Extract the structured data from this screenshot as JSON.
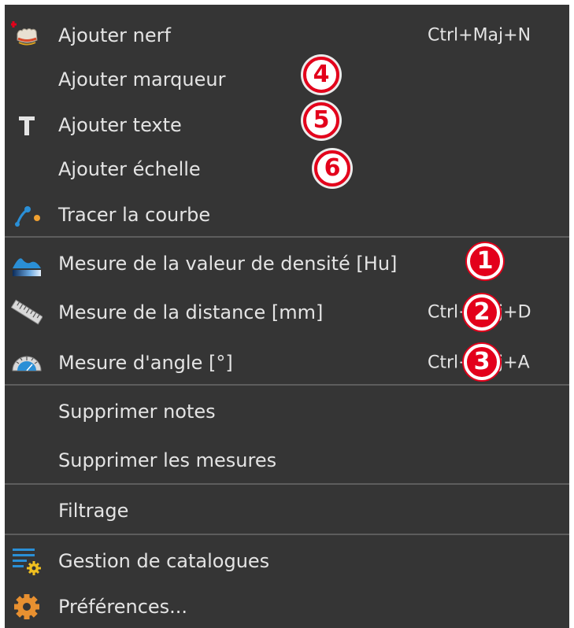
{
  "menu": {
    "items": [
      {
        "label": "Ajouter nerf",
        "shortcut": "Ctrl+Maj+N",
        "icon": "add-nerve-icon"
      },
      {
        "label": "Ajouter marqueur",
        "shortcut": "",
        "icon": ""
      },
      {
        "label": "Ajouter texte",
        "shortcut": "",
        "icon": "text-icon"
      },
      {
        "label": "Ajouter échelle",
        "shortcut": "",
        "icon": ""
      },
      {
        "label": "Tracer la courbe",
        "shortcut": "",
        "icon": "curve-icon"
      },
      {
        "label": "Mesure de la valeur de densité [Hu]",
        "shortcut": "",
        "icon": "density-icon"
      },
      {
        "label": "Mesure de la distance [mm]",
        "shortcut": "Ctrl+Maj+D",
        "icon": "ruler-icon"
      },
      {
        "label": "Mesure d'angle [°]",
        "shortcut": "Ctrl+Maj+A",
        "icon": "protractor-icon"
      },
      {
        "label": "Supprimer notes",
        "shortcut": "",
        "icon": ""
      },
      {
        "label": "Supprimer les mesures",
        "shortcut": "",
        "icon": ""
      },
      {
        "label": "Filtrage",
        "shortcut": "",
        "icon": ""
      },
      {
        "label": "Gestion de catalogues",
        "shortcut": "",
        "icon": "catalog-icon"
      },
      {
        "label": "Préférences...",
        "shortcut": "",
        "icon": "gear-icon"
      }
    ]
  },
  "badges": [
    "1",
    "2",
    "3",
    "4",
    "5",
    "6"
  ],
  "colors": {
    "menu_bg": "#353535",
    "text": "#e4e4e4",
    "separator": "#5d5d5d",
    "badge_red": "#e3001b",
    "accent_blue": "#2a8fd6",
    "accent_orange": "#f0a030"
  }
}
